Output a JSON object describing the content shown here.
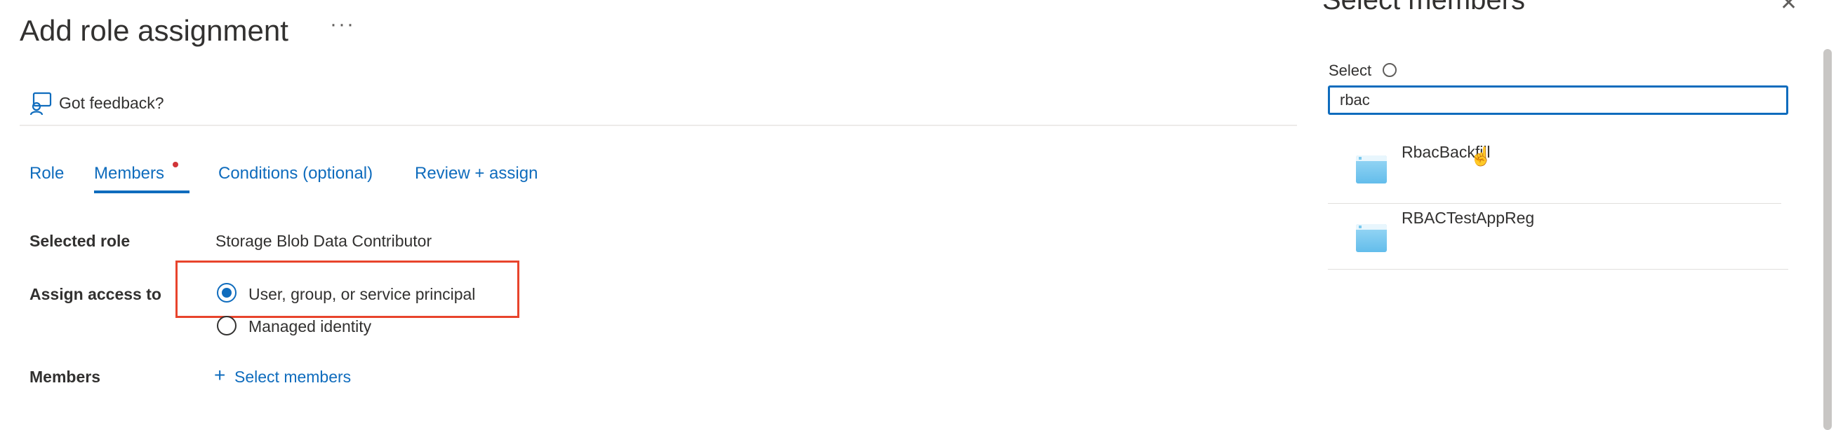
{
  "page": {
    "title": "Add role assignment",
    "more_icon": "ellipsis-icon",
    "feedback_label": "Got feedback?"
  },
  "tabs": [
    {
      "label": "Role",
      "active": false
    },
    {
      "label": "Members",
      "active": true,
      "has_error_dot": true
    },
    {
      "label": "Conditions (optional)",
      "active": false
    },
    {
      "label": "Review + assign",
      "active": false
    }
  ],
  "form": {
    "selected_role_label": "Selected role",
    "selected_role_value": "Storage Blob Data Contributor",
    "assign_access_label": "Assign access to",
    "assign_options": [
      {
        "label": "User, group, or service principal",
        "checked": true
      },
      {
        "label": "Managed identity",
        "checked": false
      }
    ],
    "members_label": "Members",
    "select_members_link": "Select members"
  },
  "select_pane": {
    "title": "Select members",
    "select_label": "Select",
    "search_value": "rbac",
    "results": [
      {
        "name": "RbacBackfill"
      },
      {
        "name": "RBACTestAppReg"
      }
    ]
  },
  "colors": {
    "accent": "#0f6cbd",
    "highlight_box": "#e8442c",
    "error_dot": "#d13438"
  }
}
